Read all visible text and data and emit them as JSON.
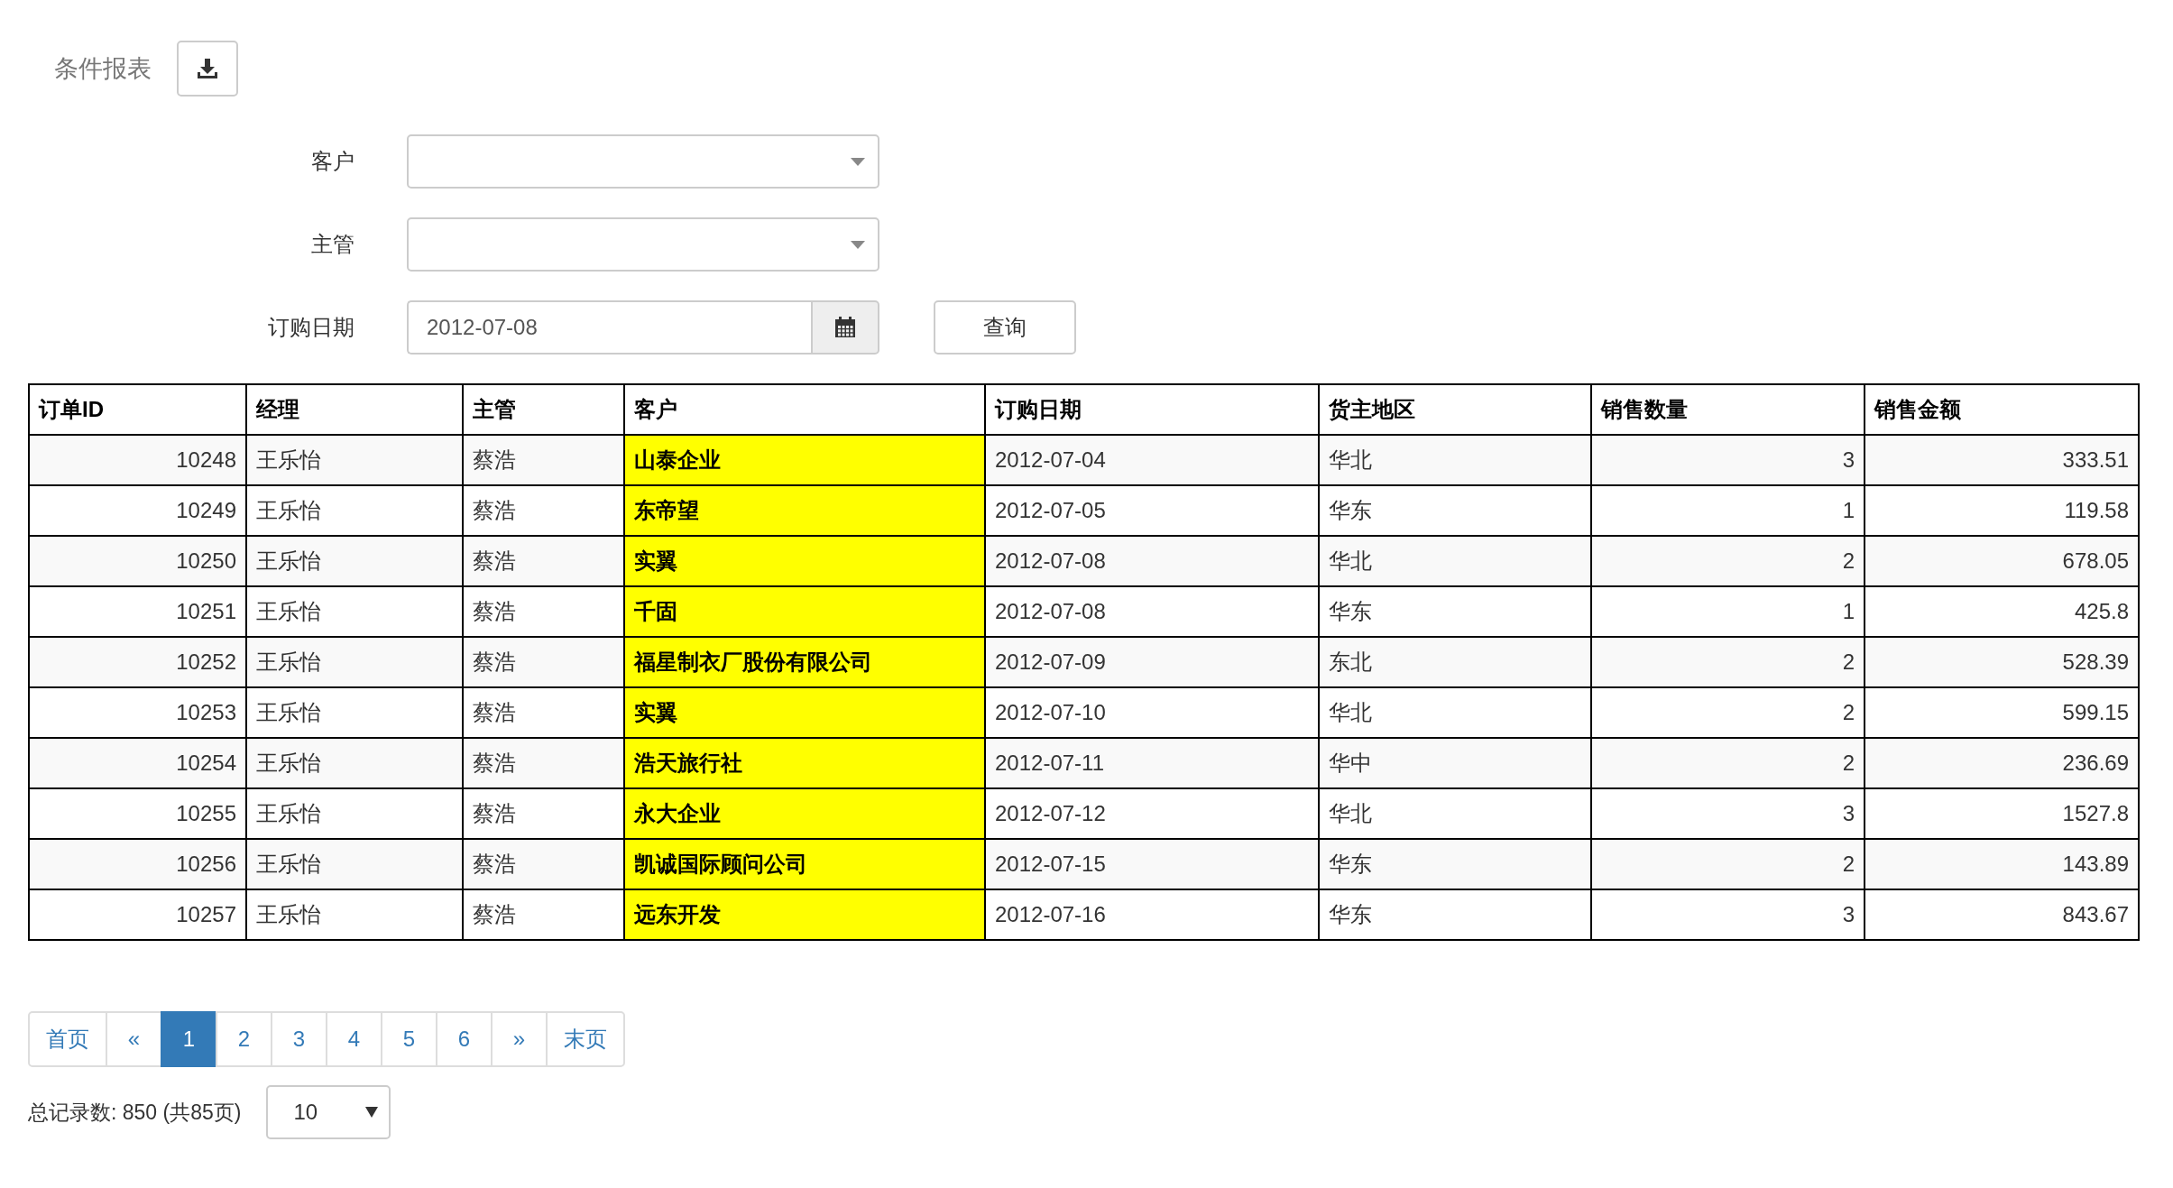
{
  "title": "条件报表",
  "filters": [
    {
      "kind": "select",
      "label": "客户"
    },
    {
      "kind": "select",
      "label": "主管"
    },
    {
      "kind": "date",
      "label": "订购日期",
      "value": "2012-07-08"
    }
  ],
  "query_button": "查询",
  "table": {
    "columns": [
      {
        "label": "订单ID",
        "kind": "number"
      },
      {
        "label": "经理",
        "kind": "text"
      },
      {
        "label": "主管",
        "kind": "text"
      },
      {
        "label": "客户",
        "kind": "highlight"
      },
      {
        "label": "订购日期",
        "kind": "text"
      },
      {
        "label": "货主地区",
        "kind": "text"
      },
      {
        "label": "销售数量",
        "kind": "number"
      },
      {
        "label": "销售金额",
        "kind": "number"
      }
    ],
    "rows": [
      [
        "10248",
        "王乐怡",
        "蔡浩",
        "山泰企业",
        "2012-07-04",
        "华北",
        "3",
        "333.51"
      ],
      [
        "10249",
        "王乐怡",
        "蔡浩",
        "东帝望",
        "2012-07-05",
        "华东",
        "1",
        "119.58"
      ],
      [
        "10250",
        "王乐怡",
        "蔡浩",
        "实翼",
        "2012-07-08",
        "华北",
        "2",
        "678.05"
      ],
      [
        "10251",
        "王乐怡",
        "蔡浩",
        "千固",
        "2012-07-08",
        "华东",
        "1",
        "425.8"
      ],
      [
        "10252",
        "王乐怡",
        "蔡浩",
        "福星制衣厂股份有限公司",
        "2012-07-09",
        "东北",
        "2",
        "528.39"
      ],
      [
        "10253",
        "王乐怡",
        "蔡浩",
        "实翼",
        "2012-07-10",
        "华北",
        "2",
        "599.15"
      ],
      [
        "10254",
        "王乐怡",
        "蔡浩",
        "浩天旅行社",
        "2012-07-11",
        "华中",
        "2",
        "236.69"
      ],
      [
        "10255",
        "王乐怡",
        "蔡浩",
        "永大企业",
        "2012-07-12",
        "华北",
        "3",
        "1527.8"
      ],
      [
        "10256",
        "王乐怡",
        "蔡浩",
        "凯诚国际顾问公司",
        "2012-07-15",
        "华东",
        "2",
        "143.89"
      ],
      [
        "10257",
        "王乐怡",
        "蔡浩",
        "远东开发",
        "2012-07-16",
        "华东",
        "3",
        "843.67"
      ]
    ]
  },
  "pagination": [
    {
      "label": "首页",
      "selected": false
    },
    {
      "label": "«",
      "selected": false
    },
    {
      "label": "1",
      "selected": true
    },
    {
      "label": "2",
      "selected": false
    },
    {
      "label": "3",
      "selected": false
    },
    {
      "label": "4",
      "selected": false
    },
    {
      "label": "5",
      "selected": false
    },
    {
      "label": "6",
      "selected": false
    },
    {
      "label": "»",
      "selected": false
    },
    {
      "label": "末页",
      "selected": false
    }
  ],
  "total_text": "总记录数: 850 (共85页)",
  "page_size": "10"
}
